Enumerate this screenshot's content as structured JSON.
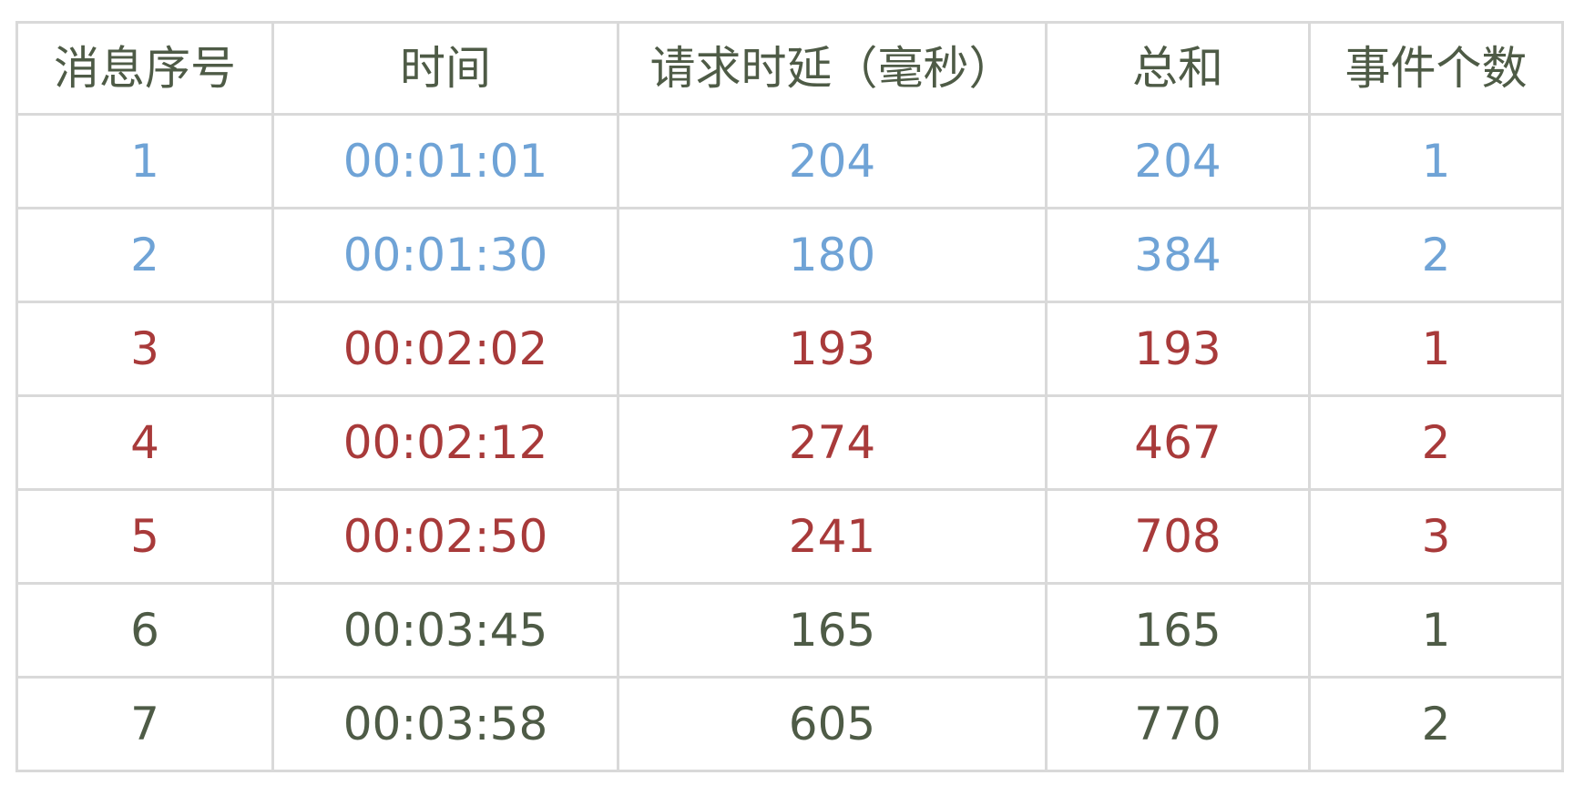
{
  "colors": {
    "blue": "#6fa3d6",
    "red": "#a83a3a",
    "dark": "#4e5b46",
    "border": "#d9d9d9"
  },
  "headers": [
    "消息序号",
    "时间",
    "请求时延（毫秒）",
    "总和",
    "事件个数"
  ],
  "rows": [
    {
      "color": "blue",
      "cells": [
        "1",
        "00:01:01",
        "204",
        "204",
        "1"
      ]
    },
    {
      "color": "blue",
      "cells": [
        "2",
        "00:01:30",
        "180",
        "384",
        "2"
      ]
    },
    {
      "color": "red",
      "cells": [
        "3",
        "00:02:02",
        "193",
        "193",
        "1"
      ]
    },
    {
      "color": "red",
      "cells": [
        "4",
        "00:02:12",
        "274",
        "467",
        "2"
      ]
    },
    {
      "color": "red",
      "cells": [
        "5",
        "00:02:50",
        "241",
        "708",
        "3"
      ]
    },
    {
      "color": "dark",
      "cells": [
        "6",
        "00:03:45",
        "165",
        "165",
        "1"
      ]
    },
    {
      "color": "dark",
      "cells": [
        "7",
        "00:03:58",
        "605",
        "770",
        "2"
      ]
    }
  ]
}
